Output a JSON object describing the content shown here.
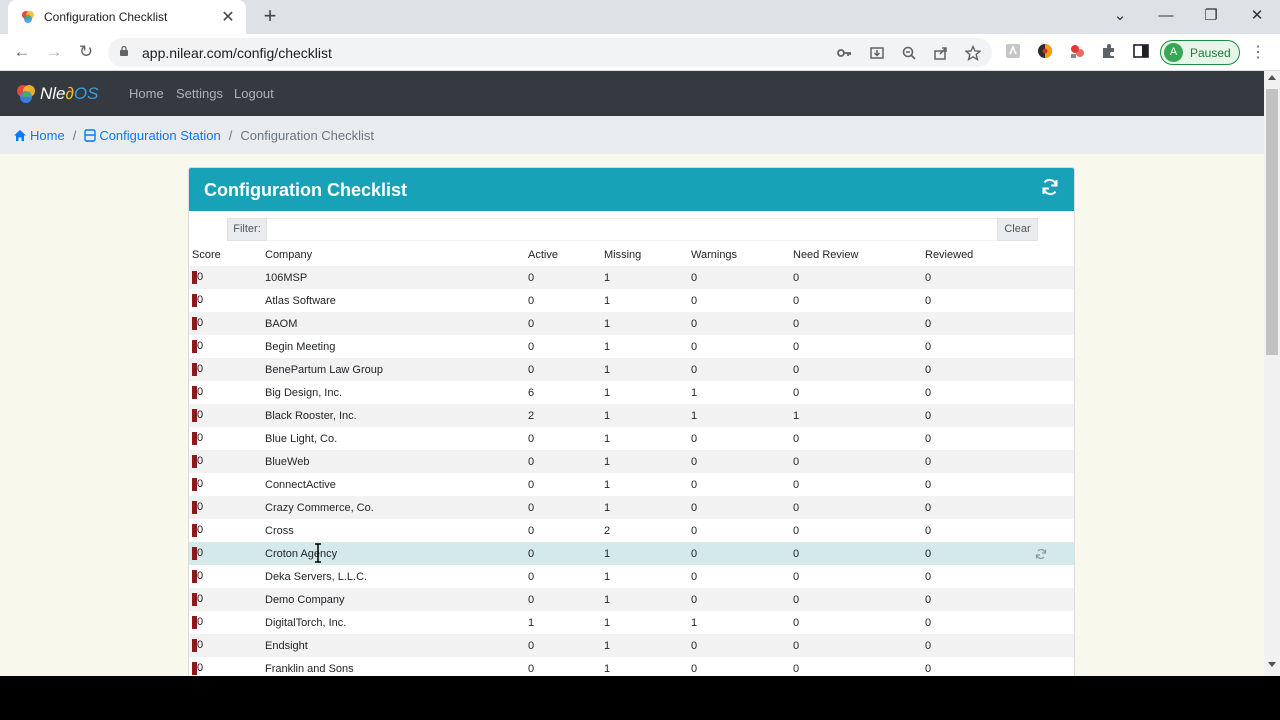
{
  "browser": {
    "tab_title": "Configuration Checklist",
    "new_tab_symbol": "+",
    "url": "app.nilear.com/config/checklist",
    "profile_initial": "A",
    "profile_status": "Paused"
  },
  "app": {
    "brand_prefix": "Nle",
    "brand_suffix": "OS",
    "nav": {
      "home": "Home",
      "settings": "Settings",
      "logout": "Logout"
    }
  },
  "breadcrumb": {
    "home": "Home",
    "station": "Configuration Station",
    "current": "Configuration Checklist",
    "separator": "/"
  },
  "card": {
    "title": "Configuration Checklist",
    "filter_label": "Filter:",
    "filter_value": "",
    "clear_label": "Clear"
  },
  "table": {
    "headers": {
      "score": "Score",
      "company": "Company",
      "active": "Active",
      "missing": "Missing",
      "warnings": "Warnings",
      "need_review": "Need Review",
      "reviewed": "Reviewed"
    },
    "rows": [
      {
        "score": "0",
        "company": "106MSP",
        "active": "0",
        "missing": "1",
        "warnings": "0",
        "need_review": "0",
        "reviewed": "0"
      },
      {
        "score": "0",
        "company": "Atlas Software",
        "active": "0",
        "missing": "1",
        "warnings": "0",
        "need_review": "0",
        "reviewed": "0"
      },
      {
        "score": "0",
        "company": "BAOM",
        "active": "0",
        "missing": "1",
        "warnings": "0",
        "need_review": "0",
        "reviewed": "0"
      },
      {
        "score": "0",
        "company": "Begin Meeting",
        "active": "0",
        "missing": "1",
        "warnings": "0",
        "need_review": "0",
        "reviewed": "0"
      },
      {
        "score": "0",
        "company": "BenePartum Law Group",
        "active": "0",
        "missing": "1",
        "warnings": "0",
        "need_review": "0",
        "reviewed": "0"
      },
      {
        "score": "0",
        "company": "Big Design, Inc.",
        "active": "6",
        "missing": "1",
        "warnings": "1",
        "need_review": "0",
        "reviewed": "0"
      },
      {
        "score": "0",
        "company": "Black Rooster, Inc.",
        "active": "2",
        "missing": "1",
        "warnings": "1",
        "need_review": "1",
        "reviewed": "0"
      },
      {
        "score": "0",
        "company": "Blue Light, Co.",
        "active": "0",
        "missing": "1",
        "warnings": "0",
        "need_review": "0",
        "reviewed": "0"
      },
      {
        "score": "0",
        "company": "BlueWeb",
        "active": "0",
        "missing": "1",
        "warnings": "0",
        "need_review": "0",
        "reviewed": "0"
      },
      {
        "score": "0",
        "company": "ConnectActive",
        "active": "0",
        "missing": "1",
        "warnings": "0",
        "need_review": "0",
        "reviewed": "0"
      },
      {
        "score": "0",
        "company": "Crazy Commerce, Co.",
        "active": "0",
        "missing": "1",
        "warnings": "0",
        "need_review": "0",
        "reviewed": "0"
      },
      {
        "score": "0",
        "company": "Cross",
        "active": "0",
        "missing": "2",
        "warnings": "0",
        "need_review": "0",
        "reviewed": "0"
      },
      {
        "score": "0",
        "company": "Croton Agency",
        "active": "0",
        "missing": "1",
        "warnings": "0",
        "need_review": "0",
        "reviewed": "0",
        "highlighted": true
      },
      {
        "score": "0",
        "company": "Deka Servers, L.L.C.",
        "active": "0",
        "missing": "1",
        "warnings": "0",
        "need_review": "0",
        "reviewed": "0"
      },
      {
        "score": "0",
        "company": "Demo Company",
        "active": "0",
        "missing": "1",
        "warnings": "0",
        "need_review": "0",
        "reviewed": "0"
      },
      {
        "score": "0",
        "company": "DigitalTorch, Inc.",
        "active": "1",
        "missing": "1",
        "warnings": "1",
        "need_review": "0",
        "reviewed": "0"
      },
      {
        "score": "0",
        "company": "Endsight",
        "active": "0",
        "missing": "1",
        "warnings": "0",
        "need_review": "0",
        "reviewed": "0"
      },
      {
        "score": "0",
        "company": "Franklin and Sons",
        "active": "0",
        "missing": "1",
        "warnings": "0",
        "need_review": "0",
        "reviewed": "0"
      }
    ]
  },
  "colors": {
    "header_teal": "#17a2b8",
    "navbar_dark": "#343a40",
    "link_blue": "#007bff",
    "score_bar": "#8b1a1a",
    "highlight_row": "#d4eaea"
  }
}
